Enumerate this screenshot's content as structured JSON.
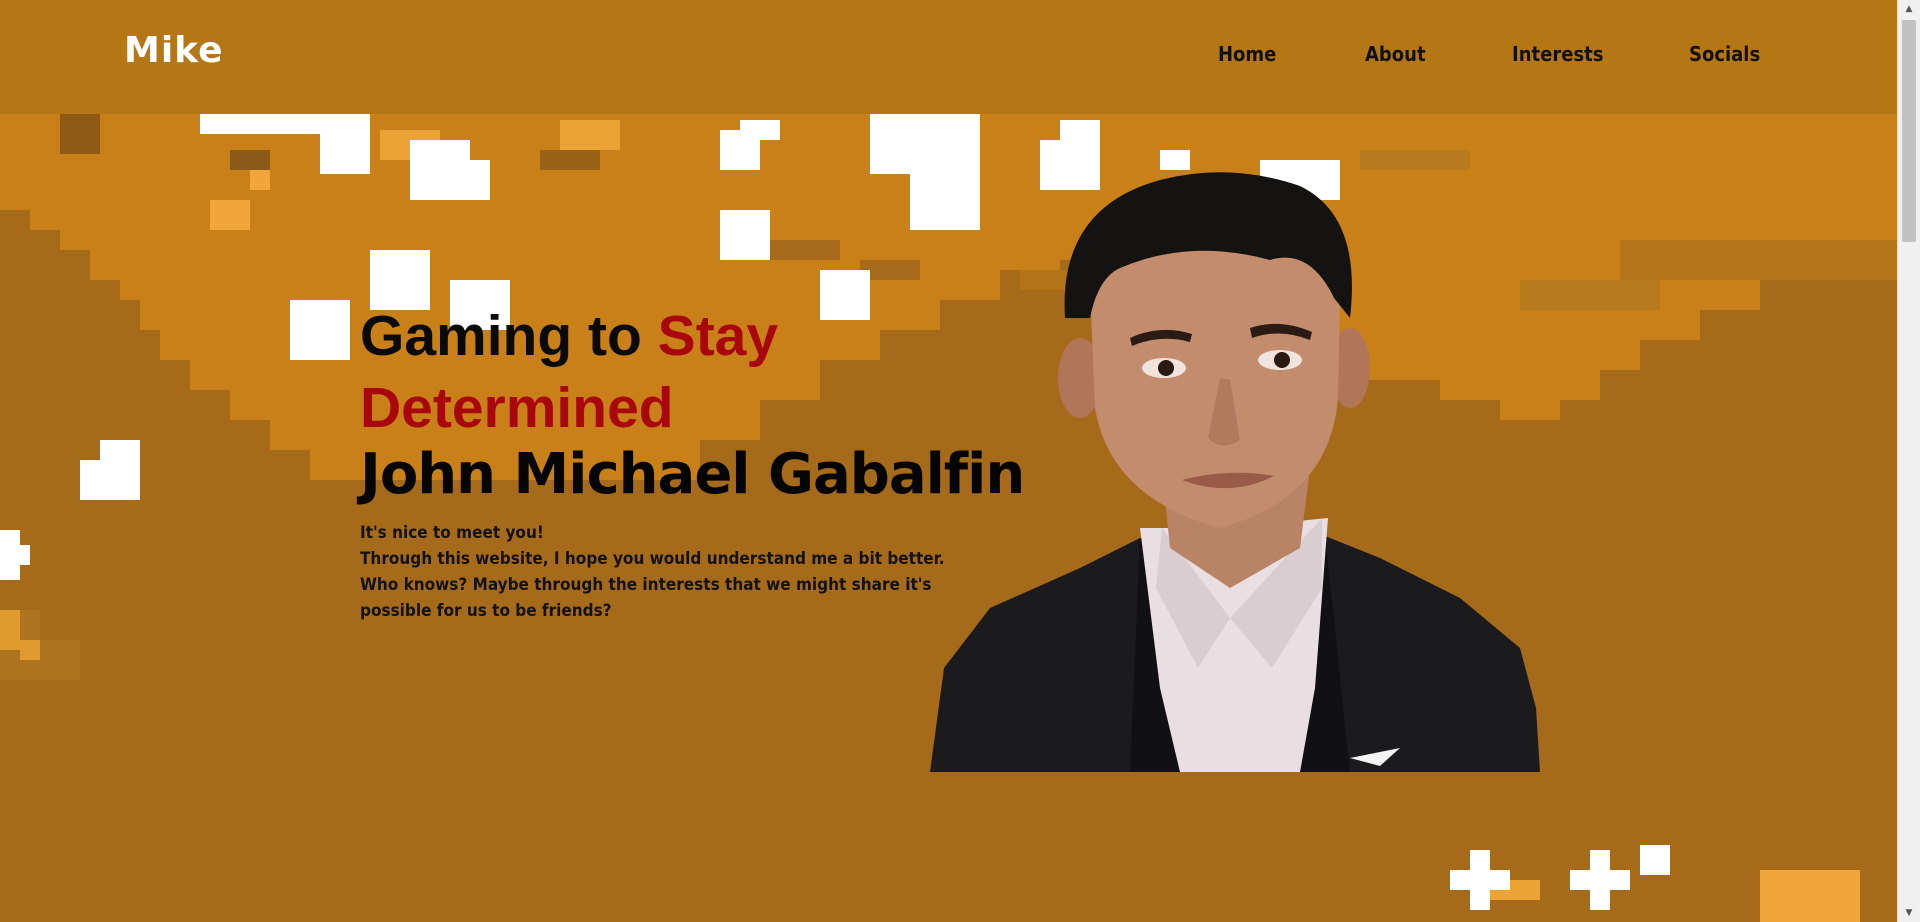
{
  "header": {
    "brand": "Mike",
    "nav": [
      {
        "label": "Home"
      },
      {
        "label": "About"
      },
      {
        "label": "Interests"
      },
      {
        "label": "Socials"
      }
    ]
  },
  "hero": {
    "title_part1": "Gaming to ",
    "title_accent": "Stay Determined",
    "name": "John Michael Gabalfin",
    "description": [
      "It's nice to meet you!",
      "Through this website, I hope you would understand me a bit better.",
      "Who knows? Maybe through the interests that we might share it's",
      "possible for us to be friends?"
    ]
  },
  "colors": {
    "background": "#c98019",
    "header_overlay": "#af7316",
    "accent_red": "#a8070b",
    "text_dark": "#0a0a0a",
    "brand_white": "#ffffff"
  },
  "icons": {
    "scroll_up": "▲",
    "scroll_down": "▼"
  }
}
